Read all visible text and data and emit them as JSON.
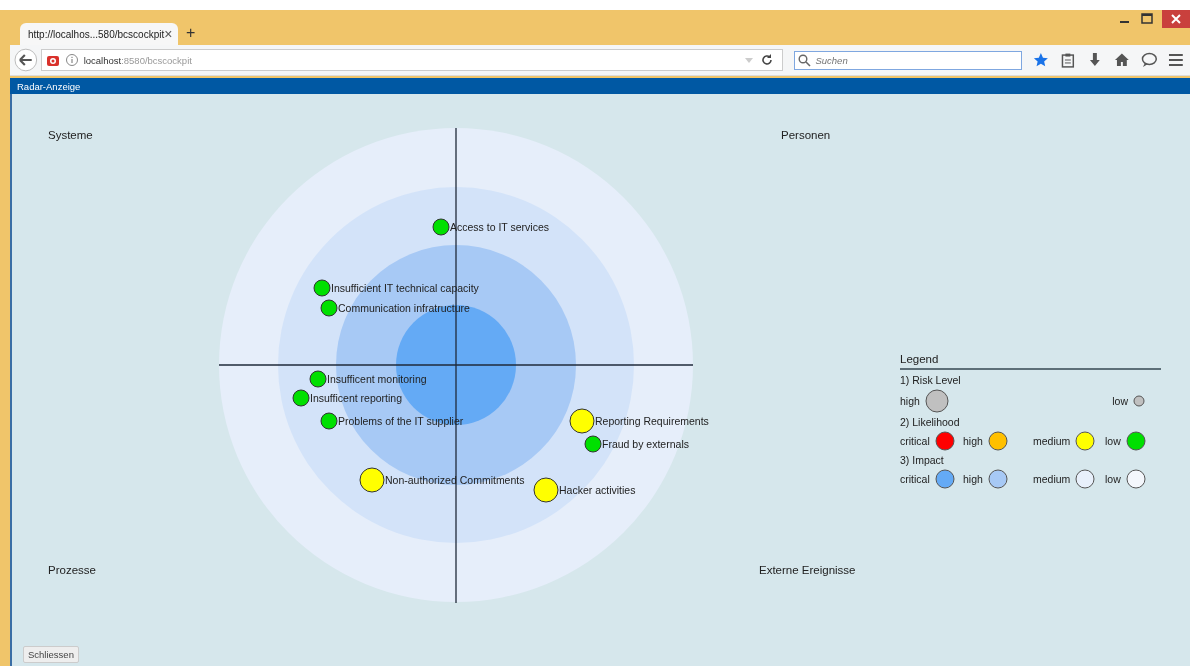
{
  "browser": {
    "tab": {
      "title": "http://localhos...580/bcscockpit",
      "close": "×"
    },
    "new_tab": "+",
    "url": "**localhost**:8580/bcscockpit",
    "search": {
      "placeholder": "Suchen"
    }
  },
  "header": {
    "title": "Radar-Anzeige"
  },
  "radar": {
    "quadrants": [
      "Systeme",
      "Personen",
      "Prozesse",
      "Externe Ereignisse"
    ],
    "risks": [
      {
        "label": "Access to IT services",
        "color": "#00e000",
        "kind": "small"
      },
      {
        "label": "Insufficient IT technical capacity",
        "color": "#00e000",
        "kind": "small"
      },
      {
        "label": "Communication infratructure",
        "color": "#00e000",
        "kind": "small"
      },
      {
        "label": "Insufficent monitoring",
        "color": "#00e000",
        "kind": "small"
      },
      {
        "label": "Insufficent reporting",
        "color": "#00e000",
        "kind": "small"
      },
      {
        "label": "Problems of the IT supplier",
        "color": "#00e000",
        "kind": "small"
      },
      {
        "label": "Reporting Requirements",
        "color": "#ffff00",
        "kind": "large"
      },
      {
        "label": "Fraud by externals",
        "color": "#00e000",
        "kind": "small"
      },
      {
        "label": "Non-authorized Commitments",
        "color": "#ffff00",
        "kind": "large"
      },
      {
        "label": "Hacker activities",
        "color": "#ffff00",
        "kind": "large"
      }
    ]
  },
  "legend": {
    "title": "Legend",
    "sections": [
      {
        "title": "1) Risk Level",
        "kind": "size",
        "items": [
          {
            "label": "high",
            "color": "#c0c0c0",
            "kind": "large"
          },
          {
            "label": "low",
            "color": "#c0c0c0",
            "kind": "small"
          }
        ]
      },
      {
        "title": "2) Likelihood",
        "kind": "grid",
        "items": [
          {
            "label": "critical",
            "color": "#ff0000"
          },
          {
            "label": "high",
            "color": "#ffc000"
          },
          {
            "label": "medium",
            "color": "#ffff00"
          },
          {
            "label": "low",
            "color": "#00e000"
          }
        ]
      },
      {
        "title": "3) Impact",
        "kind": "grid",
        "items": [
          {
            "label": "critical",
            "color": "#64aaf5"
          },
          {
            "label": "high",
            "color": "#a7c9f5"
          },
          {
            "label": "medium",
            "color": "#e8f0fb"
          },
          {
            "label": "low",
            "color": "#f4f7fc"
          }
        ]
      }
    ]
  },
  "close_button": "Schliessen"
}
